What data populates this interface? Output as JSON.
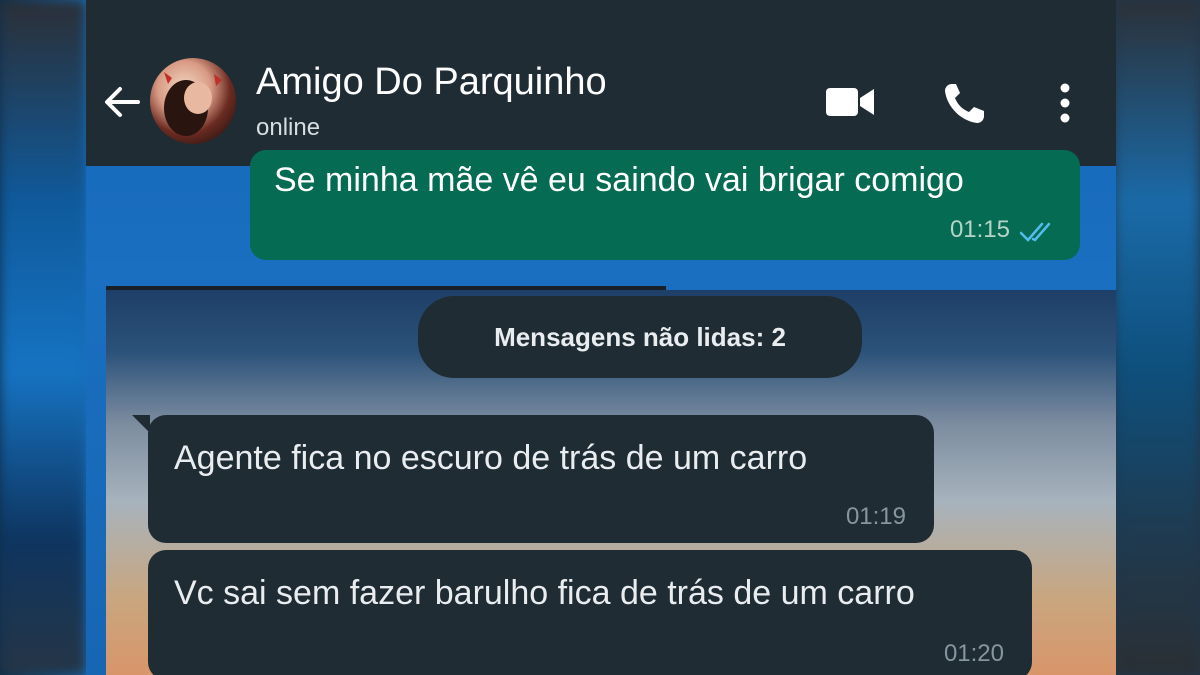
{
  "chat_header": {
    "contact_name": "Amigo Do Parquinho",
    "status": "online",
    "icons": [
      "back-arrow-icon",
      "video-call-icon",
      "voice-call-icon",
      "more-options-icon"
    ]
  },
  "messages": [
    {
      "direction": "outgoing",
      "text": "Se minha mãe vê eu saindo vai brigar comigo",
      "time": "01:15",
      "read_receipt": "double-check"
    },
    {
      "direction": "incoming",
      "text": "Agente fica no escuro de trás de um carro",
      "time": "01:19"
    },
    {
      "direction": "incoming",
      "text": "Vc sai sem fazer barulho fica de trás de um carro",
      "time": "01:20"
    }
  ],
  "unread_banner": "Mensagens não lidas: 2",
  "colors": {
    "header_bg": "#1f2c34",
    "outgoing_bubble": "#056b52",
    "incoming_bubble": "#1f2c34",
    "read_tick": "#53bdeb"
  }
}
